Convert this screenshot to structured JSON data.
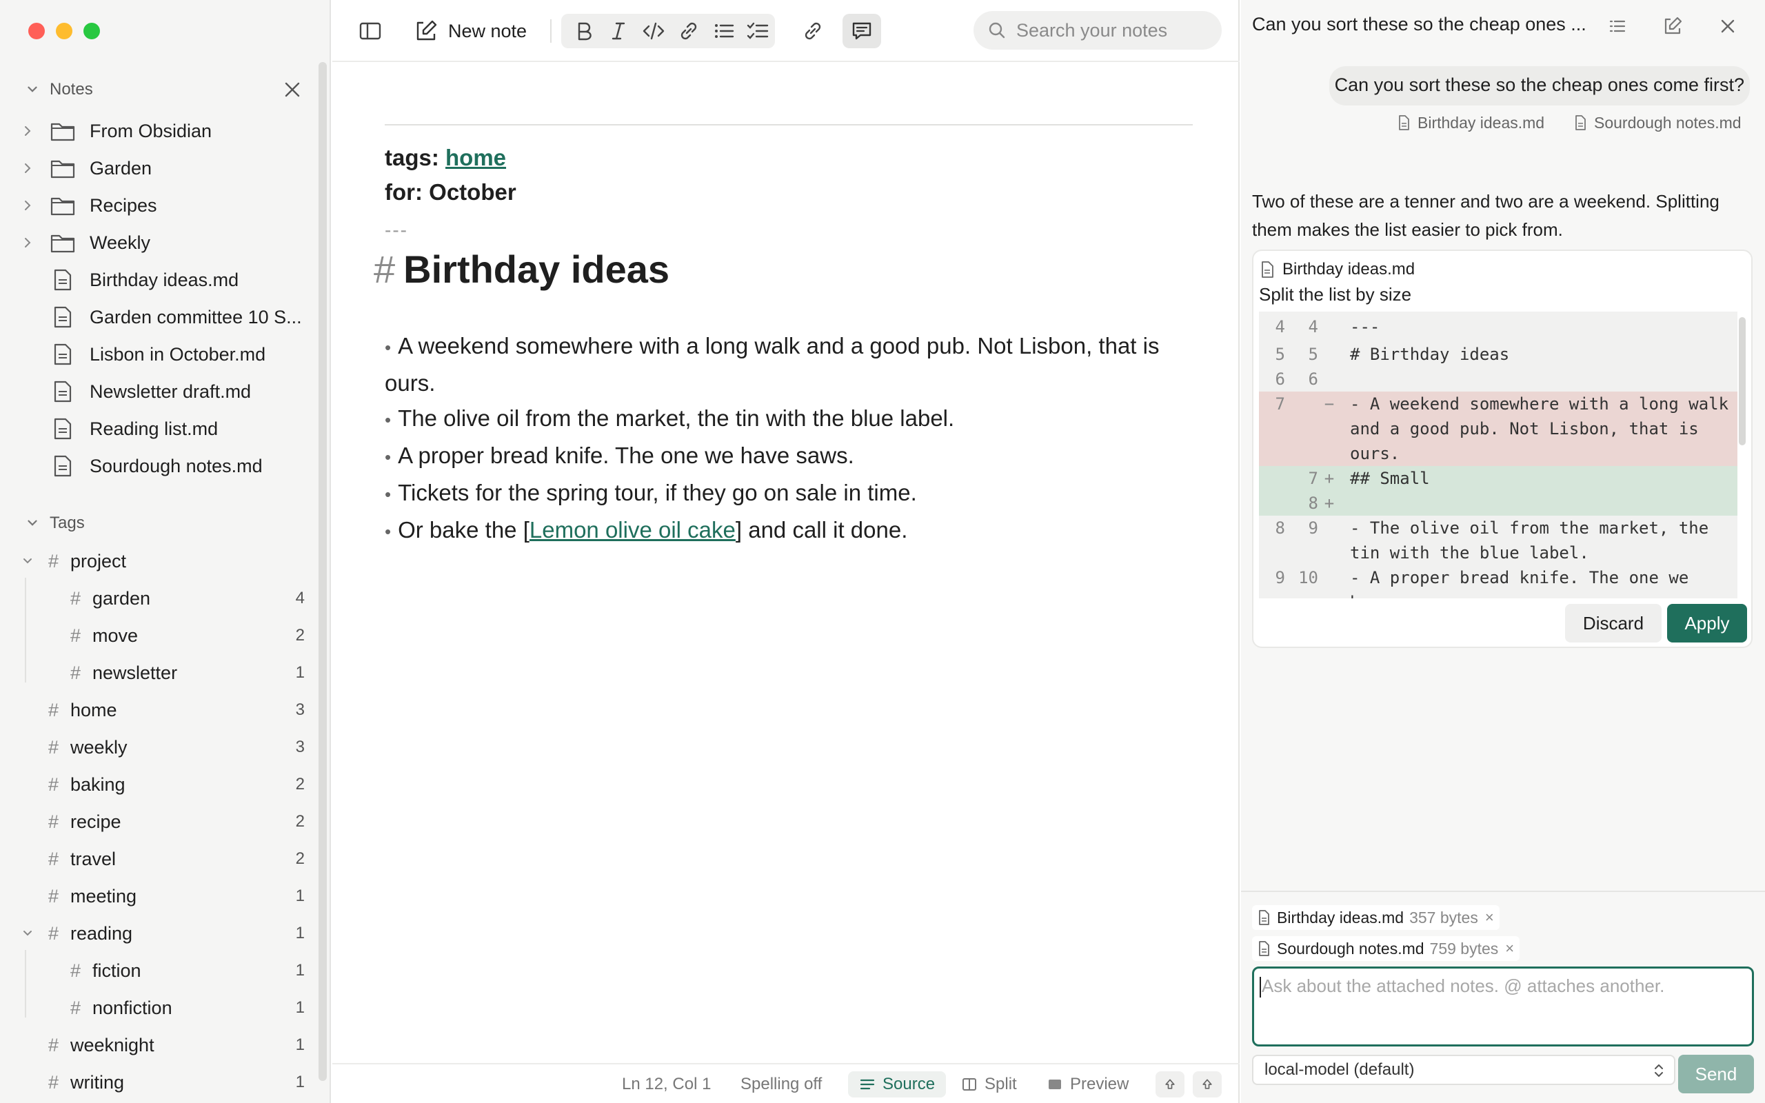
{
  "sidebar": {
    "notes_header": "Notes",
    "tree": [
      {
        "label": "From Obsidian",
        "kind": "folder"
      },
      {
        "label": "Garden",
        "kind": "folder"
      },
      {
        "label": "Recipes",
        "kind": "folder"
      },
      {
        "label": "Weekly",
        "kind": "folder"
      },
      {
        "label": "Birthday ideas.md",
        "kind": "file"
      },
      {
        "label": "Garden committee 10 S...",
        "kind": "file"
      },
      {
        "label": "Lisbon in October.md",
        "kind": "file"
      },
      {
        "label": "Newsletter draft.md",
        "kind": "file"
      },
      {
        "label": "Reading list.md",
        "kind": "file"
      },
      {
        "label": "Sourdough notes.md",
        "kind": "file"
      }
    ],
    "tags_header": "Tags",
    "tags": [
      {
        "label": "project",
        "count": ""
      },
      {
        "label": "garden",
        "count": "4"
      },
      {
        "label": "move",
        "count": "2"
      },
      {
        "label": "newsletter",
        "count": "1"
      },
      {
        "label": "home",
        "count": "3"
      },
      {
        "label": "weekly",
        "count": "3"
      },
      {
        "label": "baking",
        "count": "2"
      },
      {
        "label": "recipe",
        "count": "2"
      },
      {
        "label": "travel",
        "count": "2"
      },
      {
        "label": "meeting",
        "count": "1"
      },
      {
        "label": "reading",
        "count": "1"
      },
      {
        "label": "fiction",
        "count": "1"
      },
      {
        "label": "nonfiction",
        "count": "1"
      },
      {
        "label": "weeknight",
        "count": "1"
      },
      {
        "label": "writing",
        "count": "1"
      }
    ],
    "hash": "#"
  },
  "toolbar": {
    "new_note_label": "New note",
    "search_placeholder": "Search your notes"
  },
  "document": {
    "tags_key": "tags:",
    "tags_value": "home",
    "for_line": "for: October",
    "separator": "---",
    "heading_mark": "#",
    "heading": "Birthday ideas",
    "bullet": "•",
    "items": [
      {
        "text": "A weekend somewhere with a long walk and a good pub. Not Lisbon, that is ours."
      },
      {
        "text": "The olive oil from the market, the tin with the blue label."
      },
      {
        "text": "A proper bread knife. The one we have saws."
      },
      {
        "text": "Tickets for the spring tour, if they go on sale in time."
      }
    ],
    "last_item_prefix": "Or bake the [",
    "last_item_link": "Lemon olive oil cake",
    "last_item_suffix": "] and call it done."
  },
  "statusbar": {
    "position": "Ln 12, Col 1",
    "spelling": "Spelling off",
    "mode_source": "Source",
    "mode_split": "Split",
    "mode_preview": "Preview"
  },
  "chat": {
    "title": "Can you sort these so the cheap ones ...",
    "user_message": "Can you sort these so the cheap ones come first?",
    "user_attachments": [
      "Birthday ideas.md",
      "Sourdough notes.md"
    ],
    "assistant_message": "Two of these are a tenner and two are a weekend. Splitting them makes the list easier to pick from.",
    "diff": {
      "file": "Birthday ideas.md",
      "description": "Split the list by size",
      "lines": [
        {
          "old": "4",
          "new": "4",
          "mark": "",
          "type": "ctx",
          "text": "---"
        },
        {
          "old": "5",
          "new": "5",
          "mark": "",
          "type": "ctx",
          "text": "# Birthday ideas"
        },
        {
          "old": "6",
          "new": "6",
          "mark": "",
          "type": "ctx",
          "text": ""
        },
        {
          "old": "7",
          "new": "",
          "mark": "−",
          "type": "del",
          "text": "- A weekend somewhere with a long walk and a good pub. Not Lisbon, that is ours."
        },
        {
          "old": "",
          "new": "7",
          "mark": "+",
          "type": "add",
          "text": "## Small"
        },
        {
          "old": "",
          "new": "8",
          "mark": "+",
          "type": "add",
          "text": ""
        },
        {
          "old": "8",
          "new": "9",
          "mark": "",
          "type": "ctx",
          "text": "- The olive oil from the market, the tin with the blue label."
        },
        {
          "old": "9",
          "new": "10",
          "mark": "",
          "type": "ctx",
          "text": "- A proper bread knife. The one we have saws."
        }
      ],
      "discard_label": "Discard",
      "apply_label": "Apply"
    },
    "attachments": [
      {
        "name": "Birthday ideas.md",
        "size": "357 bytes"
      },
      {
        "name": "Sourdough notes.md",
        "size": "759 bytes"
      }
    ],
    "remove_glyph": "×",
    "input_placeholder": "Ask about the attached notes. @ attaches another.",
    "model": "local-model (default)",
    "send_label": "Send"
  },
  "colors": {
    "accent": "#1f6f5c",
    "traffic_red": "#ff5f57",
    "traffic_yellow": "#febc2e",
    "traffic_green": "#28c840",
    "diff_deleted": "#ebd6d3",
    "diff_added": "#d6e6da"
  },
  "icons": [
    "sidebar-toggle-icon",
    "new-note-icon",
    "bold-icon",
    "italic-icon",
    "code-icon",
    "link-icon",
    "bullet-list-icon",
    "checklist-icon",
    "insert-link-icon",
    "chat-icon",
    "search-icon",
    "folder-icon",
    "file-icon",
    "chevron-icon",
    "close-icon",
    "list-icon",
    "compose-icon",
    "arrow-up-icon"
  ]
}
